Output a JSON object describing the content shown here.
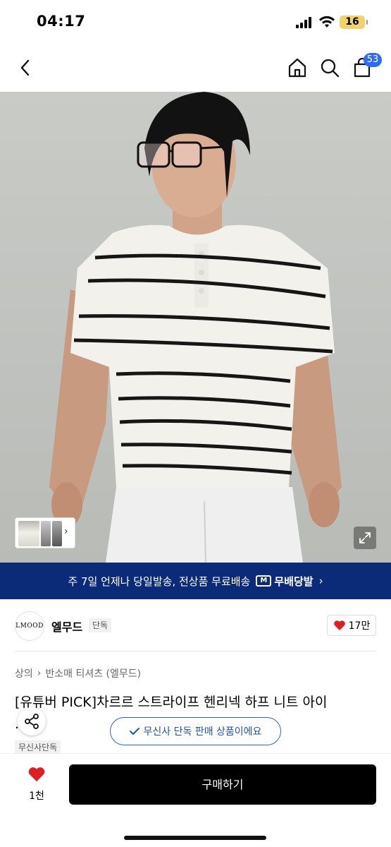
{
  "status_bar": {
    "time": "04:17",
    "battery": "16",
    "icons": [
      "signal-icon",
      "wifi-icon",
      "battery-icon"
    ]
  },
  "nav": {
    "back_icon": "chevron-left-icon",
    "home_icon": "home-icon",
    "search_icon": "search-icon",
    "cart_icon": "shopping-bag-icon",
    "cart_count": "53",
    "badge_color": "#2e6cf0"
  },
  "gallery": {
    "expand_icon": "expand-icon",
    "thumbnail_arrow": "›"
  },
  "promo": {
    "text": "주 7일 언제나 당일발송, 전상품 무료배송",
    "logo_mark": "M",
    "logo_text": "무배당발",
    "arrow": "›",
    "bg_color": "#0b2a78"
  },
  "brand": {
    "logo_text": "LMOOD",
    "name": "엘무드",
    "tag": "단독",
    "like_count": "17만",
    "heart_color": "#e02020"
  },
  "breadcrumb": {
    "level1": "상의",
    "separator": "›",
    "level2": "반소매 티셔츠 (엘무드)"
  },
  "product": {
    "title": "[유튜버 PICK]차르르 스트라이프 헨리넥 하프 니트 아이",
    "title_line2": "...",
    "exclusive_pill": "무신사 단독 판매 상품이에요",
    "exclusive_badge": "무신사단독",
    "share_icon": "share-icon"
  },
  "bottom_bar": {
    "wish_count": "1천",
    "buy_label": "구매하기"
  }
}
